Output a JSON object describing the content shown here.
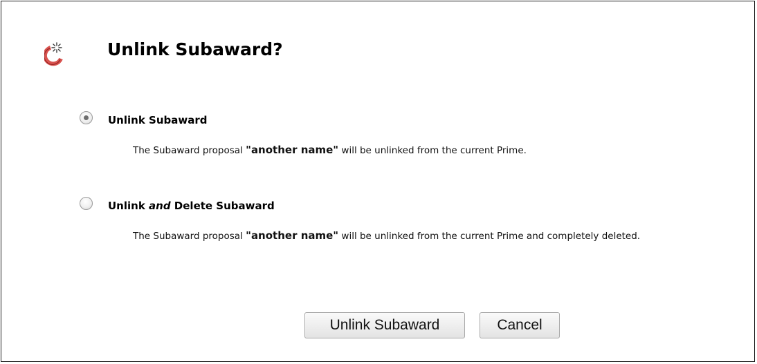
{
  "dialog": {
    "icon": "spinner-gear-icon",
    "title": "Unlink Subaward?"
  },
  "options": [
    {
      "selected": true,
      "label_before": "Unlink Subaward",
      "label_italic": "",
      "label_after": "",
      "desc_before": "The Subaward proposal ",
      "desc_name": "\"another name\"",
      "desc_after": " will be unlinked from the current Prime."
    },
    {
      "selected": false,
      "label_before": "Unlink ",
      "label_italic": "and",
      "label_after": " Delete Subaward",
      "desc_before": "The Subaward proposal ",
      "desc_name": "\"another name\"",
      "desc_after": " will be unlinked from the current Prime and completely deleted."
    }
  ],
  "buttons": {
    "confirm_label": "Unlink Subaward",
    "cancel_label": "Cancel"
  },
  "colors": {
    "icon_accent": "#d9534f",
    "icon_dark": "#3a3a3a"
  }
}
